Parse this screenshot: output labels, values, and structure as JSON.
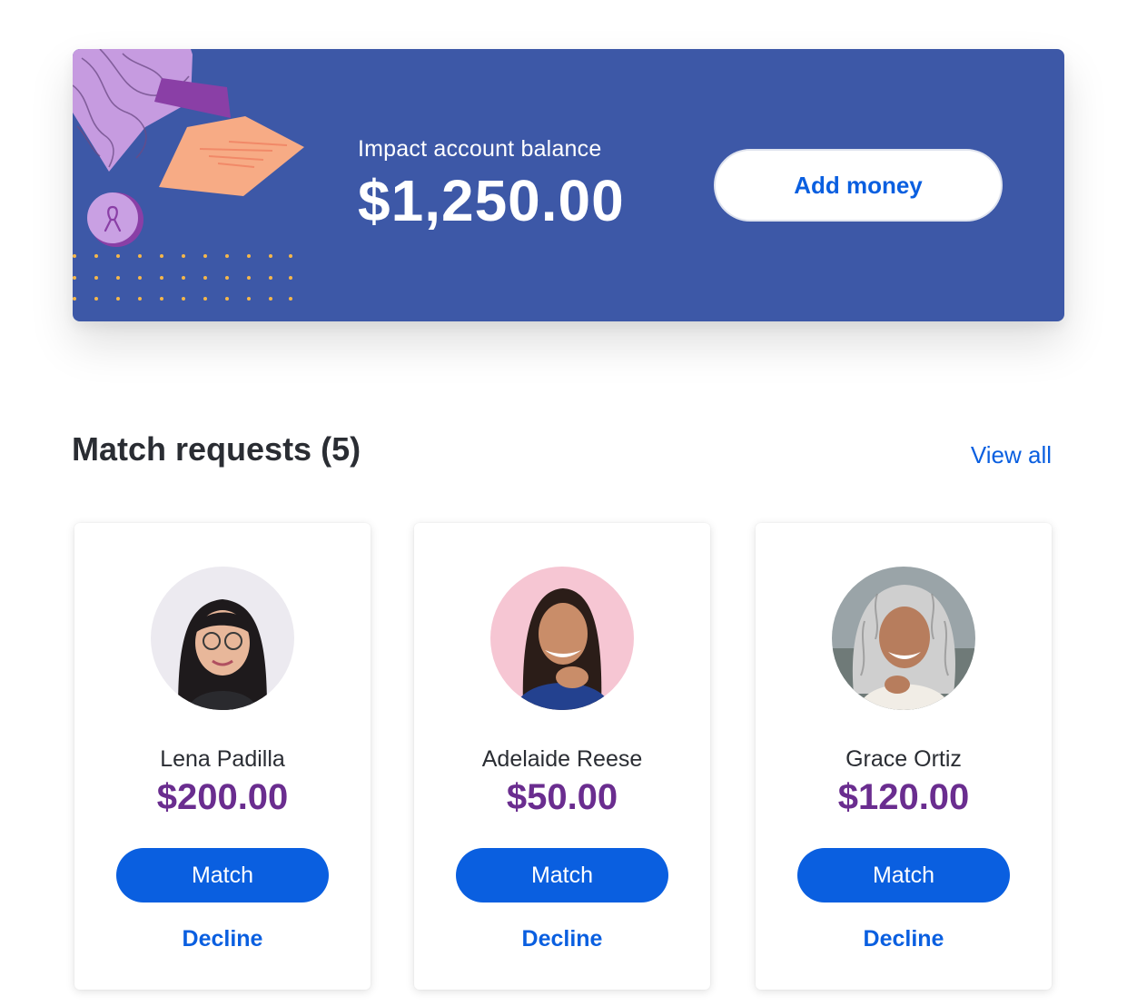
{
  "balance": {
    "label": "Impact account balance",
    "amount": "$1,250.00",
    "add_money_label": "Add money"
  },
  "requests": {
    "title": "Match requests (5)",
    "view_all_label": "View all",
    "cards": [
      {
        "name": "Lena Padilla",
        "amount": "$200.00",
        "match_label": "Match",
        "decline_label": "Decline"
      },
      {
        "name": "Adelaide Reese",
        "amount": "$50.00",
        "match_label": "Match",
        "decline_label": "Decline"
      },
      {
        "name": "Grace Ortiz",
        "amount": "$120.00",
        "match_label": "Match",
        "decline_label": "Decline"
      }
    ]
  },
  "colors": {
    "banner": "#3d58a7",
    "accent": "#0a5fe0",
    "amount": "#6a2d8f"
  }
}
